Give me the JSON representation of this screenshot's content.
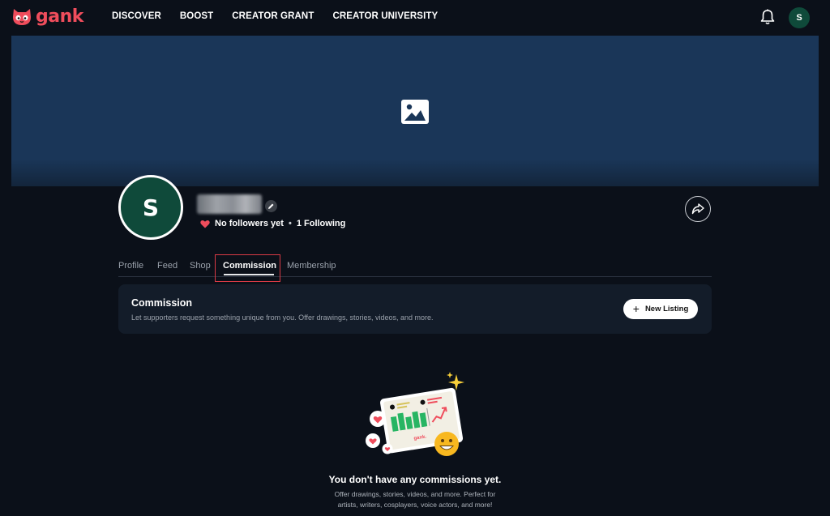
{
  "brand": {
    "name": "gank",
    "accent": "#ef4d5c"
  },
  "nav": {
    "links": [
      "DISCOVER",
      "BOOST",
      "CREATOR GRANT",
      "CREATOR UNIVERSITY"
    ],
    "avatar_initial": "S"
  },
  "profile": {
    "avatar_initial": "S",
    "followers_text": "No followers yet",
    "separator": "•",
    "following_text": "1 Following"
  },
  "tabs": [
    "Profile",
    "Feed",
    "Shop",
    "Commission",
    "Membership"
  ],
  "active_tab": "Commission",
  "commission_card": {
    "title": "Commission",
    "description": "Let supporters request something unique from you. Offer drawings, stories, videos, and more.",
    "button_icon": "+",
    "button_label": "New Listing"
  },
  "empty_state": {
    "title": "You don't have any commissions yet.",
    "description_line1": "Offer drawings, stories, videos, and more. Perfect for",
    "description_line2": "artists, writers, cosplayers, voice actors, and more!",
    "illustration_brand": "gank."
  },
  "colors": {
    "background": "#0b1019",
    "banner": "#1a3658",
    "avatar": "#0f4a3a",
    "highlight": "#d93a45"
  }
}
